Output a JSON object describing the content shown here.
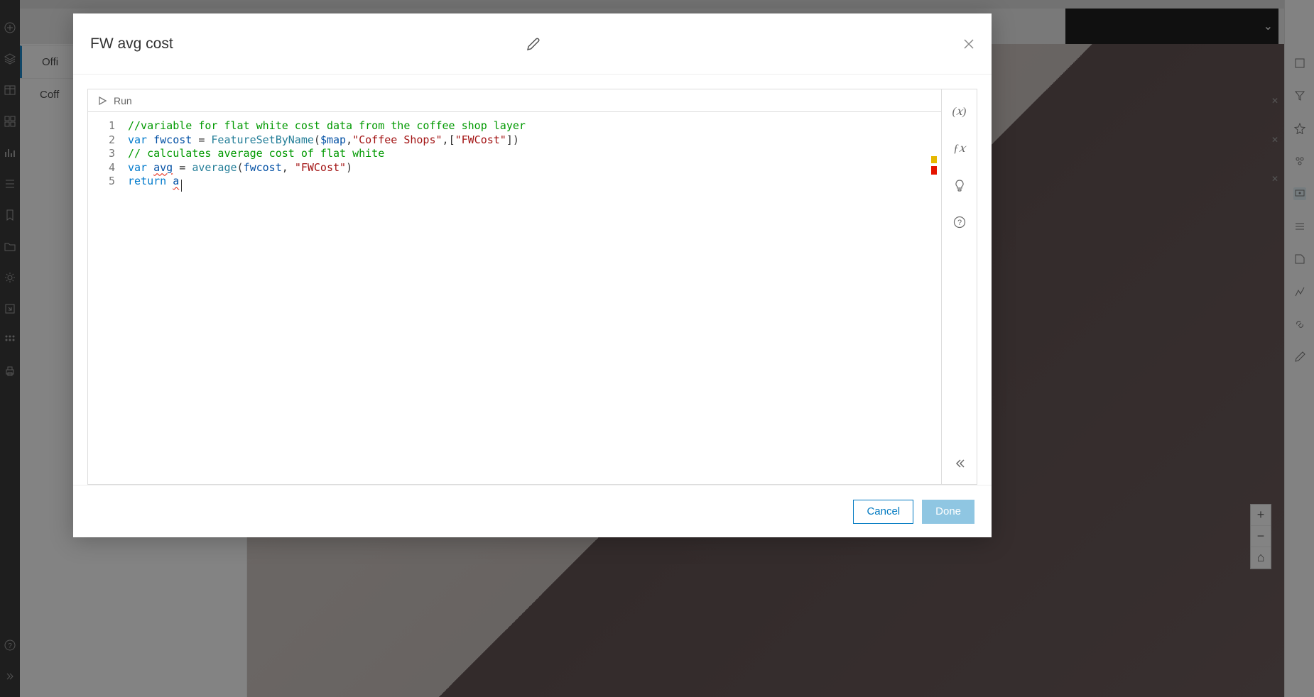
{
  "background": {
    "layers_heading": "Layers",
    "row1": "Offi",
    "row2": "Coff"
  },
  "modal": {
    "title": "FW avg cost",
    "run_label": "Run",
    "cancel_label": "Cancel",
    "done_label": "Done",
    "code": {
      "line_numbers": [
        "1",
        "2",
        "3",
        "4",
        "5"
      ],
      "line1": {
        "comment": "//variable for flat white cost data from the coffee shop layer"
      },
      "line2": {
        "kw_var": "var",
        "sp1": " ",
        "var_name": "fwcost",
        "sp2": " = ",
        "func": "FeatureSetByName",
        "p1": "(",
        "arg_map": "$map",
        "c1": ",",
        "str1": "\"Coffee Shops\"",
        "c2": ",",
        "br1": "[",
        "str2": "\"FWCost\"",
        "br2": "]",
        "p2": ")"
      },
      "line3": {
        "comment": "// calculates average cost of flat white"
      },
      "line4": {
        "kw_var": "var",
        "sp1": " ",
        "var_name": "avg",
        "sp2": " = ",
        "func": "average",
        "p1": "(",
        "arg1": "fwcost",
        "c1": ", ",
        "str1": "\"FWCost\"",
        "p2": ")"
      },
      "line5": {
        "kw_return": "return",
        "sp1": " ",
        "expr": "a"
      }
    }
  },
  "tool_rail": {
    "variables": "(𝑥)",
    "functions": "ƒ𝑥",
    "suggestions": "💡",
    "help": "?"
  }
}
